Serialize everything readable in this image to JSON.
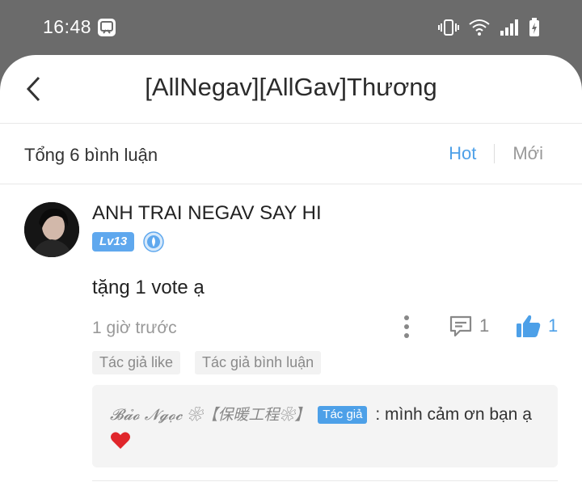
{
  "status_bar": {
    "time": "16:48"
  },
  "header": {
    "title": "[AllNegav][AllGav]Thương"
  },
  "comments_bar": {
    "count_label": "Tổng 6 bình luận",
    "sort_hot": "Hot",
    "sort_new": "Mới"
  },
  "comment": {
    "username": "ANH TRAI NEGAV SAY HI",
    "level": "Lv13",
    "text": "tặng 1 vote ạ",
    "time": "1 giờ trước",
    "reply_count": "1",
    "like_count": "1",
    "tags": [
      "Tác giả like",
      "Tác giả bình luận"
    ]
  },
  "reply": {
    "name": "𝓑𝓪̉𝓸 𝓝𝓰𝓸̣𝓬 ❀【保暖工程❀】",
    "badge": "Tác giả",
    "separator": ":",
    "text": "mình cảm ơn bạn ạ"
  },
  "colors": {
    "accent": "#4da0e8",
    "muted": "#999999",
    "status_bar_bg": "#6b6b6b"
  }
}
